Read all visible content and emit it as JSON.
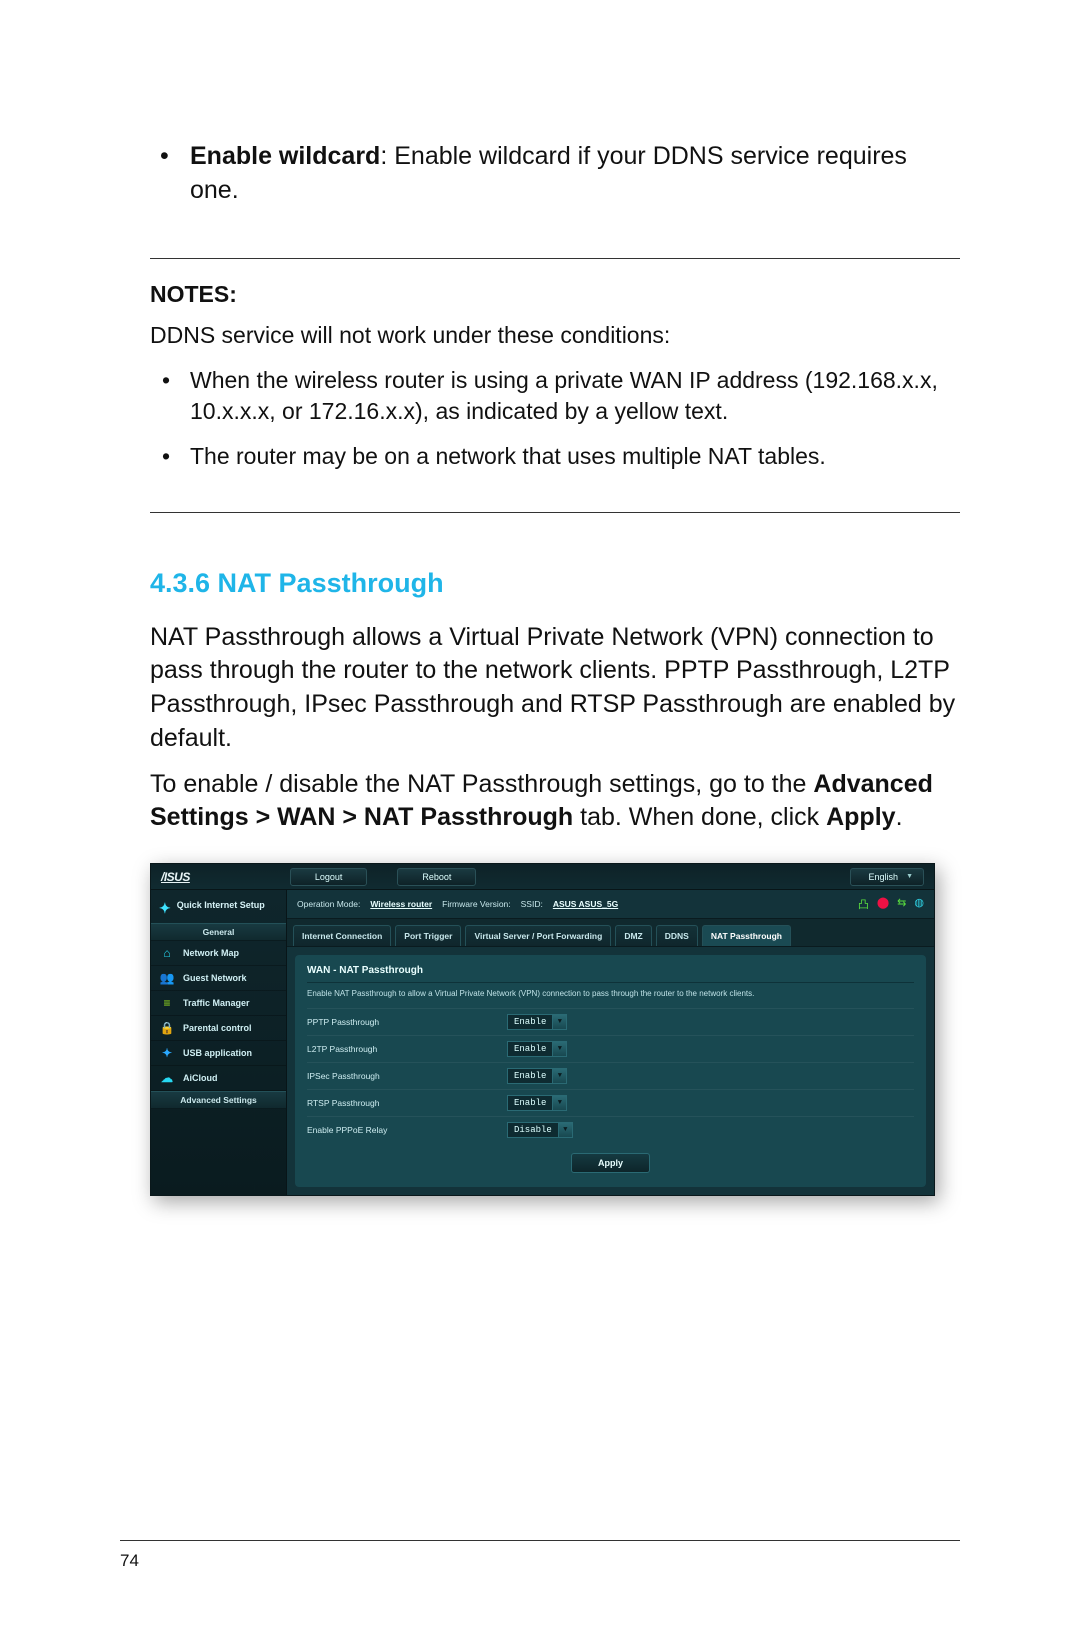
{
  "doc": {
    "bullet_bold": "Enable wildcard",
    "bullet_rest": ": Enable wildcard if your DDNS service requires one.",
    "notes_heading": "NOTES",
    "notes_intro": "DDNS service will not work under these conditions:",
    "notes_items": [
      "When the wireless router is using a private WAN IP address (192.168.x.x, 10.x.x.x, or 172.16.x.x), as indicated by a yellow text.",
      "The router may be on a network that uses multiple NAT tables."
    ],
    "section_heading": "4.3.6 NAT Passthrough",
    "para1": "NAT Passthrough allows a Virtual Private Network (VPN) connection to pass through the router to the network clients. PPTP Passthrough, L2TP Passthrough, IPsec Passthrough and RTSP Passthrough are enabled by default.",
    "para2_pre": "To enable / disable the NAT Passthrough settings, go to the ",
    "para2_bold": "Advanced Settings > WAN > NAT Passthrough",
    "para2_mid": " tab. When done, click ",
    "para2_bold2": "Apply",
    "para2_end": ".",
    "pagenum": "74"
  },
  "ui": {
    "logo": "/ISUS",
    "top_buttons": {
      "logout": "Logout",
      "reboot": "Reboot"
    },
    "language": "English",
    "qis": "Quick Internet Setup",
    "group_general": "General",
    "group_advanced": "Advanced Settings",
    "sidebar": {
      "network_map": "Network Map",
      "guest_network": "Guest Network",
      "traffic_manager": "Traffic Manager",
      "parental_control": "Parental control",
      "usb_application": "USB application",
      "aicloud": "AiCloud"
    },
    "info": {
      "opmode_label": "Operation Mode:",
      "opmode_value": "Wireless router",
      "fw_label": "Firmware Version:",
      "ssid_label": "SSID:",
      "ssid_value": "ASUS  ASUS_5G"
    },
    "tabs": [
      "Internet Connection",
      "Port Trigger",
      "Virtual Server / Port Forwarding",
      "DMZ",
      "DDNS",
      "NAT Passthrough"
    ],
    "active_tab": "NAT Passthrough",
    "panel_title": "WAN - NAT Passthrough",
    "panel_desc": "Enable NAT Passthrough to allow a Virtual Private Network (VPN) connection to pass through the router to the network clients.",
    "rows": [
      {
        "label": "PPTP Passthrough",
        "value": "Enable"
      },
      {
        "label": "L2TP Passthrough",
        "value": "Enable"
      },
      {
        "label": "IPSec Passthrough",
        "value": "Enable"
      },
      {
        "label": "RTSP Passthrough",
        "value": "Enable"
      },
      {
        "label": "Enable PPPoE Relay",
        "value": "Disable"
      }
    ],
    "apply": "Apply"
  }
}
